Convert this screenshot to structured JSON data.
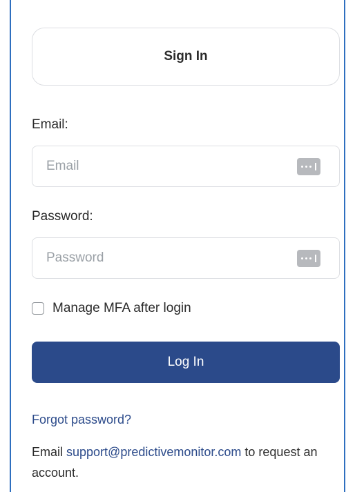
{
  "sign_in": {
    "title": "Sign In"
  },
  "email": {
    "label": "Email:",
    "placeholder": "Email",
    "value": ""
  },
  "password": {
    "label": "Password:",
    "placeholder": "Password",
    "value": "",
    "icon": "password-manager-icon"
  },
  "mfa": {
    "label": "Manage MFA after login",
    "checked": false
  },
  "login_button": {
    "label": "Log In"
  },
  "forgot": {
    "label": "Forgot password?"
  },
  "request": {
    "prefix": "Email ",
    "support_email": "support@predictivemonitor.com",
    "suffix": " to request an account."
  },
  "colors": {
    "primary": "#2b4a8a",
    "frame_border": "#2e6fbf",
    "input_border": "#dcdee2",
    "placeholder": "#9aa0a6"
  }
}
